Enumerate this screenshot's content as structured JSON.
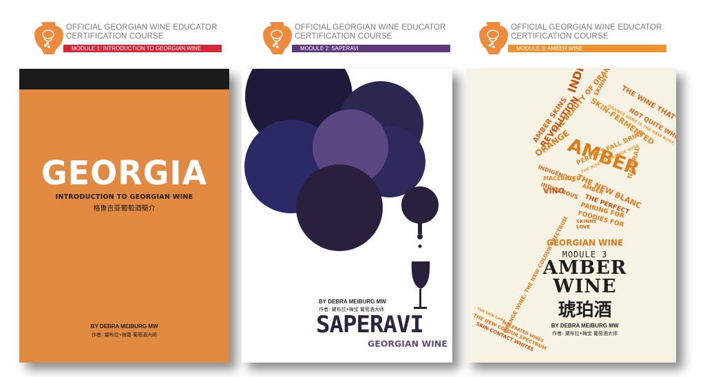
{
  "headers": [
    {
      "line1": "OFFICIAL GEORGIAN WINE EDUCATOR",
      "line2": "CERTIFICATION COURSE",
      "module": "MODULE 1: INTRODUCTION TO GEORGIAN WINE",
      "color": "#d4283a"
    },
    {
      "line1": "OFFICIAL GEORGIAN WINE EDUCATOR",
      "line2": "CERTIFICATION COURSE",
      "module": "MODULE 2: SAPERAVI",
      "color": "#5e3a7d"
    },
    {
      "line1": "OFFICIAL GEORGIAN WINE EDUCATOR",
      "line2": "CERTIFICATION COURSE",
      "module": "MODULE 3: AMBER WINE",
      "color": "#f0922e"
    }
  ],
  "logo_color": "#ef8a3c",
  "book1": {
    "title": "GEORGIA",
    "subtitle": "INTRODUCTION TO GEORGIAN WINE",
    "subtitle_cn": "格鲁吉亚葡萄酒簡介",
    "author": "BY DEBRA MEIBURG MW",
    "author_cn": "作者: 黛布拉•梅寶 葡萄酒大師",
    "bg_color": "#e28a42"
  },
  "book2": {
    "author": "BY DEBRA MEIBURG MW",
    "author_cn": "作者: 黛布拉•梅宝 葡萄酒大师",
    "title": "SAPERAVI",
    "subtitle": "GEORGIAN WINE",
    "grape_colors": [
      "#1d1a3b",
      "#2e2a5e",
      "#5a4782",
      "#2a1f3d"
    ]
  },
  "book3": {
    "label": "GEORGIAN WINE",
    "module": "MODULE  3",
    "title_line1": "AMBER",
    "title_line2": "WINE",
    "title_cn": "琥珀酒",
    "author": "BY DEBRA MEIBURG MW",
    "author_cn": "作者: 黛布拉•梅宝 葡萄酒大师",
    "word_cloud": [
      "AMBER",
      "INDIGENOUS",
      "SKIN-FERMENTED",
      "THE WINE THAT'S NOT QUITE RED",
      "NOT QUITE WHITE",
      "ORANGE WINE IS THE NEW ROSÉ",
      "SKINNY",
      "THE BEAUTY OF ORANGE",
      "REVOLUTION",
      "AMBER SKINS",
      "ORANGE",
      "PERFECT FALL DRINK",
      "THE RISE OF ORANGE WINE",
      "INDIGENOUS",
      "THE NEW BLANC",
      "MACERATED",
      "VINO",
      "AMBER",
      "INDIGENOUS",
      "NATURAL",
      "THE PERFECT",
      "PAIRING FOR",
      "FOODIES FOR",
      "SKINNY",
      "LOVE",
      "ORANGE WINE: THE NEW COLOUR SPECTRUM",
      "THE SKIN GAME",
      "MACERATED WINES",
      "THE NEW COLOUR SPECTRUM",
      "SKIN-CONTACT WHITES",
      "SKIN",
      "TIGHT"
    ]
  }
}
